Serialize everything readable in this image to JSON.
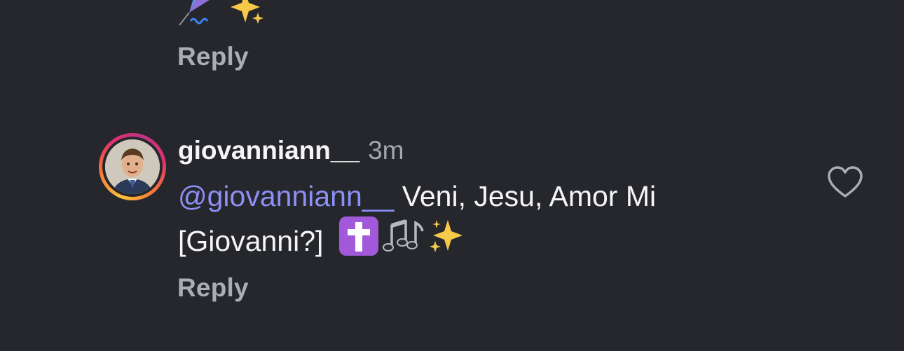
{
  "previous_comment": {
    "emojis": [
      "kite-icon",
      "sparkles-icon"
    ],
    "reply_label": "Reply"
  },
  "comment": {
    "username": "giovanniann__",
    "timestamp": "3m",
    "mention": "@giovanniann__",
    "text": " Veni, Jesu, Amor Mi [Giovanni?]",
    "emojis": [
      "latin-cross-icon",
      "musical-notes-icon",
      "sparkles-icon"
    ],
    "reply_label": "Reply",
    "liked": false
  },
  "colors": {
    "background": "#25272c",
    "mention": "#8c8ff5",
    "secondary_text": "#a9adb5"
  }
}
